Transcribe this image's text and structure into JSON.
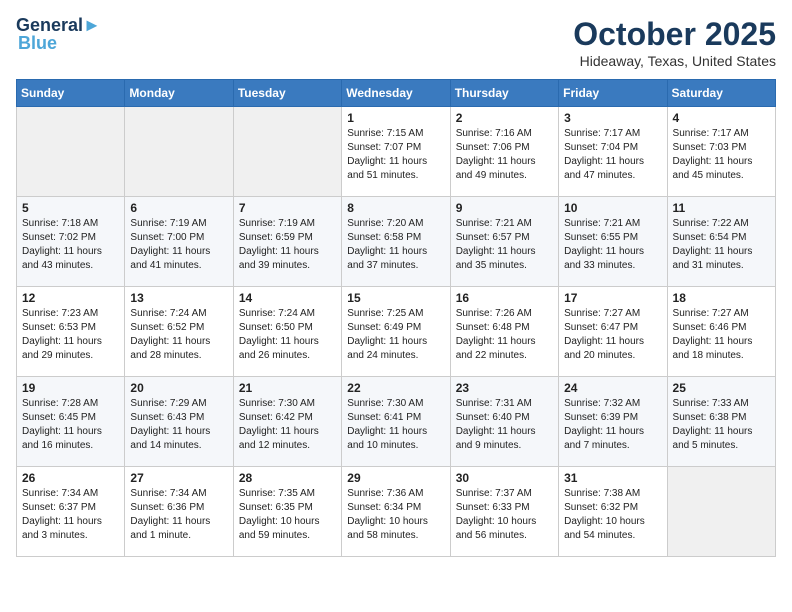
{
  "header": {
    "logo_line1": "General",
    "logo_line2": "Blue",
    "month": "October 2025",
    "location": "Hideaway, Texas, United States"
  },
  "days_of_week": [
    "Sunday",
    "Monday",
    "Tuesday",
    "Wednesday",
    "Thursday",
    "Friday",
    "Saturday"
  ],
  "weeks": [
    [
      {
        "day": "",
        "empty": true
      },
      {
        "day": "",
        "empty": true
      },
      {
        "day": "",
        "empty": true
      },
      {
        "day": "1",
        "sunrise": "7:15 AM",
        "sunset": "7:07 PM",
        "daylight": "11 hours and 51 minutes."
      },
      {
        "day": "2",
        "sunrise": "7:16 AM",
        "sunset": "7:06 PM",
        "daylight": "11 hours and 49 minutes."
      },
      {
        "day": "3",
        "sunrise": "7:17 AM",
        "sunset": "7:04 PM",
        "daylight": "11 hours and 47 minutes."
      },
      {
        "day": "4",
        "sunrise": "7:17 AM",
        "sunset": "7:03 PM",
        "daylight": "11 hours and 45 minutes."
      }
    ],
    [
      {
        "day": "5",
        "sunrise": "7:18 AM",
        "sunset": "7:02 PM",
        "daylight": "11 hours and 43 minutes."
      },
      {
        "day": "6",
        "sunrise": "7:19 AM",
        "sunset": "7:00 PM",
        "daylight": "11 hours and 41 minutes."
      },
      {
        "day": "7",
        "sunrise": "7:19 AM",
        "sunset": "6:59 PM",
        "daylight": "11 hours and 39 minutes."
      },
      {
        "day": "8",
        "sunrise": "7:20 AM",
        "sunset": "6:58 PM",
        "daylight": "11 hours and 37 minutes."
      },
      {
        "day": "9",
        "sunrise": "7:21 AM",
        "sunset": "6:57 PM",
        "daylight": "11 hours and 35 minutes."
      },
      {
        "day": "10",
        "sunrise": "7:21 AM",
        "sunset": "6:55 PM",
        "daylight": "11 hours and 33 minutes."
      },
      {
        "day": "11",
        "sunrise": "7:22 AM",
        "sunset": "6:54 PM",
        "daylight": "11 hours and 31 minutes."
      }
    ],
    [
      {
        "day": "12",
        "sunrise": "7:23 AM",
        "sunset": "6:53 PM",
        "daylight": "11 hours and 29 minutes."
      },
      {
        "day": "13",
        "sunrise": "7:24 AM",
        "sunset": "6:52 PM",
        "daylight": "11 hours and 28 minutes."
      },
      {
        "day": "14",
        "sunrise": "7:24 AM",
        "sunset": "6:50 PM",
        "daylight": "11 hours and 26 minutes."
      },
      {
        "day": "15",
        "sunrise": "7:25 AM",
        "sunset": "6:49 PM",
        "daylight": "11 hours and 24 minutes."
      },
      {
        "day": "16",
        "sunrise": "7:26 AM",
        "sunset": "6:48 PM",
        "daylight": "11 hours and 22 minutes."
      },
      {
        "day": "17",
        "sunrise": "7:27 AM",
        "sunset": "6:47 PM",
        "daylight": "11 hours and 20 minutes."
      },
      {
        "day": "18",
        "sunrise": "7:27 AM",
        "sunset": "6:46 PM",
        "daylight": "11 hours and 18 minutes."
      }
    ],
    [
      {
        "day": "19",
        "sunrise": "7:28 AM",
        "sunset": "6:45 PM",
        "daylight": "11 hours and 16 minutes."
      },
      {
        "day": "20",
        "sunrise": "7:29 AM",
        "sunset": "6:43 PM",
        "daylight": "11 hours and 14 minutes."
      },
      {
        "day": "21",
        "sunrise": "7:30 AM",
        "sunset": "6:42 PM",
        "daylight": "11 hours and 12 minutes."
      },
      {
        "day": "22",
        "sunrise": "7:30 AM",
        "sunset": "6:41 PM",
        "daylight": "11 hours and 10 minutes."
      },
      {
        "day": "23",
        "sunrise": "7:31 AM",
        "sunset": "6:40 PM",
        "daylight": "11 hours and 9 minutes."
      },
      {
        "day": "24",
        "sunrise": "7:32 AM",
        "sunset": "6:39 PM",
        "daylight": "11 hours and 7 minutes."
      },
      {
        "day": "25",
        "sunrise": "7:33 AM",
        "sunset": "6:38 PM",
        "daylight": "11 hours and 5 minutes."
      }
    ],
    [
      {
        "day": "26",
        "sunrise": "7:34 AM",
        "sunset": "6:37 PM",
        "daylight": "11 hours and 3 minutes."
      },
      {
        "day": "27",
        "sunrise": "7:34 AM",
        "sunset": "6:36 PM",
        "daylight": "11 hours and 1 minute."
      },
      {
        "day": "28",
        "sunrise": "7:35 AM",
        "sunset": "6:35 PM",
        "daylight": "10 hours and 59 minutes."
      },
      {
        "day": "29",
        "sunrise": "7:36 AM",
        "sunset": "6:34 PM",
        "daylight": "10 hours and 58 minutes."
      },
      {
        "day": "30",
        "sunrise": "7:37 AM",
        "sunset": "6:33 PM",
        "daylight": "10 hours and 56 minutes."
      },
      {
        "day": "31",
        "sunrise": "7:38 AM",
        "sunset": "6:32 PM",
        "daylight": "10 hours and 54 minutes."
      },
      {
        "day": "",
        "empty": true
      }
    ]
  ]
}
